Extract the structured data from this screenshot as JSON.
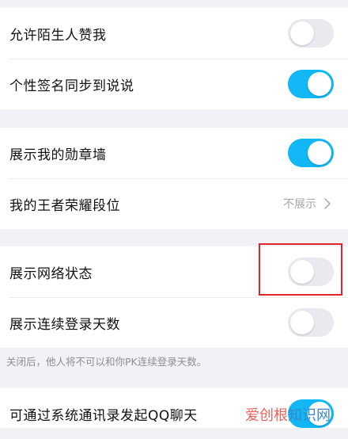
{
  "colors": {
    "toggle_on": "#12b7f5",
    "toggle_off": "#e9e9ef",
    "highlight": "#e0262d",
    "background": "#f2f2f6"
  },
  "section1": {
    "allow_stranger_like": {
      "label": "允许陌生人赞我",
      "state": "off"
    },
    "sync_signature": {
      "label": "个性签名同步到说说",
      "state": "on"
    }
  },
  "section2": {
    "medal_wall": {
      "label": "展示我的勋章墙",
      "state": "on"
    },
    "king_rank": {
      "label": "我的王者荣耀段位",
      "value": "不展示",
      "icon": "chevron-right-icon"
    }
  },
  "section3": {
    "network_status": {
      "label": "展示网络状态",
      "state": "off"
    },
    "login_days": {
      "label": "展示连续登录天数",
      "state": "off"
    },
    "footnote": "关闭后，他人将不可以和你PK连续登录天数。"
  },
  "section4": {
    "contacts_qq_chat": {
      "label": "可通过系统通讯录发起QQ聊天",
      "state": "on"
    }
  },
  "watermark": {
    "brand": "爱创根",
    "suffix": "知识网"
  }
}
